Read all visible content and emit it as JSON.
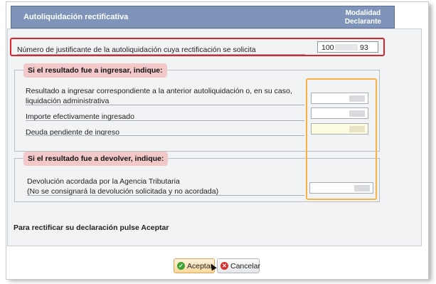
{
  "header": {
    "title": "Autoliquidación rectificativa",
    "modalidad_line1": "Modalidad",
    "modalidad_line2": "Declarante"
  },
  "numero_justificante": {
    "label": "Número de justificante de la autoliquidación cuya rectificación se solicita",
    "value_start": "100",
    "value_end": "93"
  },
  "ingresar": {
    "legend": "Si el resultado fue a ingresar, indique:",
    "resultado_label_line1": "Resultado a ingresar correspondiente a la anterior autoliquidación o, en su caso,",
    "resultado_label_line2": "liquidación administrativa",
    "importe_label": "Importe efectivamente ingresado",
    "deuda_label": "Deuda pendiente de ingreso"
  },
  "devolver": {
    "legend": "Si el resultado fue a devolver, indique:",
    "devolucion_label_line1": "Devolución acordada por la Agencia Tributaria",
    "devolucion_label_line2": "(No se consignará la devolución solicitada y no acordada)"
  },
  "footer": {
    "instruction": "Para rectificar su declaración pulse Aceptar"
  },
  "buttons": {
    "accept": "Aceptar",
    "cancel": "Cancelar"
  },
  "colors": {
    "header_bg": "#7f94b9",
    "highlight_red": "#e0232a",
    "highlight_orange": "#f5b343",
    "legend_bg": "#f3c8c9"
  },
  "icons": {
    "accept": "check-circle-icon",
    "cancel": "close-circle-icon"
  }
}
